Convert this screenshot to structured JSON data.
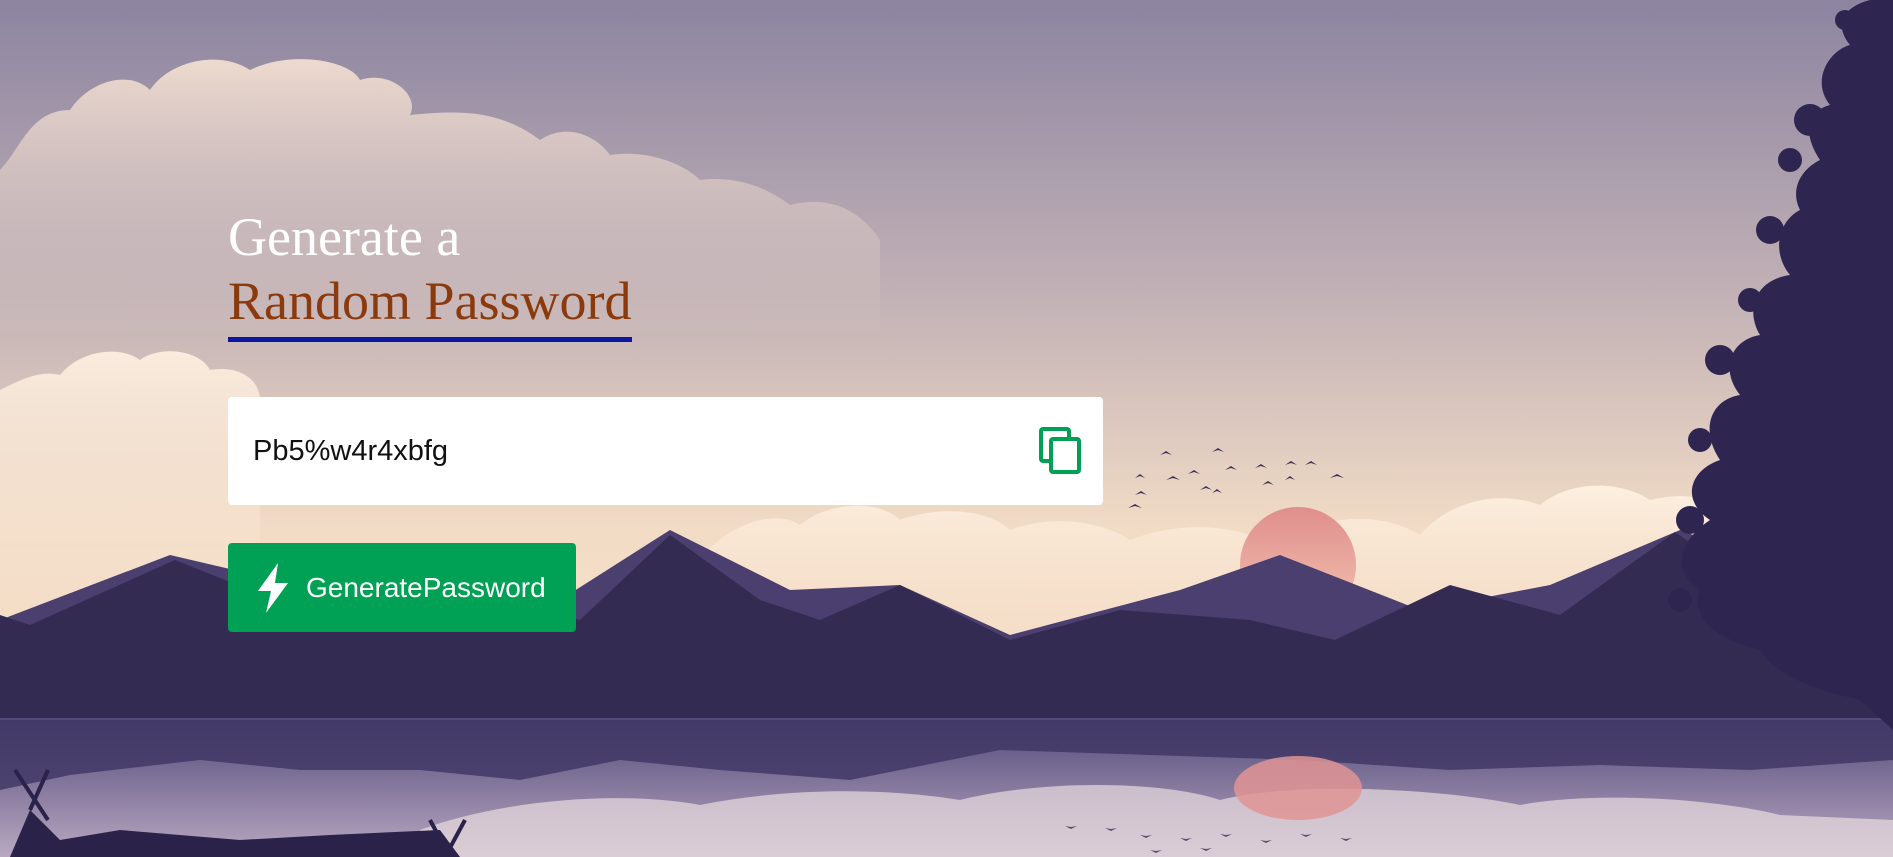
{
  "header": {
    "title_line1": "Generate a",
    "title_line2": "Random Password"
  },
  "password_field": {
    "value": "Pb5%w4r4xbfg",
    "copy_icon": "copy-icon"
  },
  "generate_button": {
    "label": "GeneratePassword",
    "icon": "lightning-bolt-icon"
  },
  "colors": {
    "title_primary": "#ffffff",
    "title_accent": "#8a3a0c",
    "underline": "#0b16a3",
    "button_bg": "#00a155",
    "copy_icon": "#00a155"
  }
}
